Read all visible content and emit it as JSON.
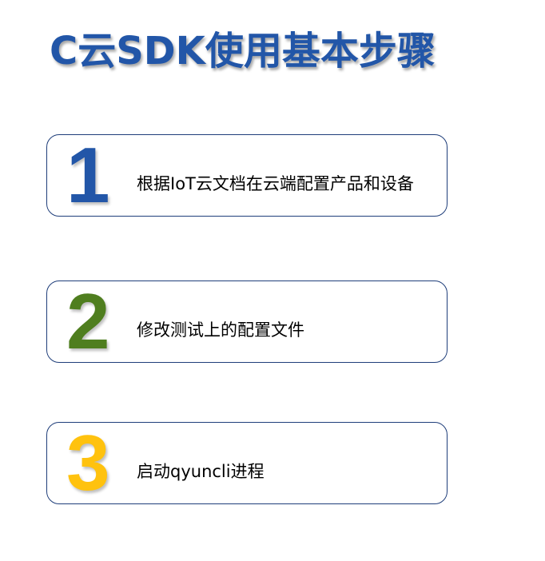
{
  "title": "C云SDK使用基本步骤",
  "steps": [
    {
      "number": "1",
      "text": "根据IoT云文档在云端配置产品和设备",
      "color": "#2256a8"
    },
    {
      "number": "2",
      "text": "修改测试上的配置文件",
      "color": "#4f7e1f"
    },
    {
      "number": "3",
      "text": "启动qyuncli进程",
      "color": "#ffc20e"
    }
  ]
}
